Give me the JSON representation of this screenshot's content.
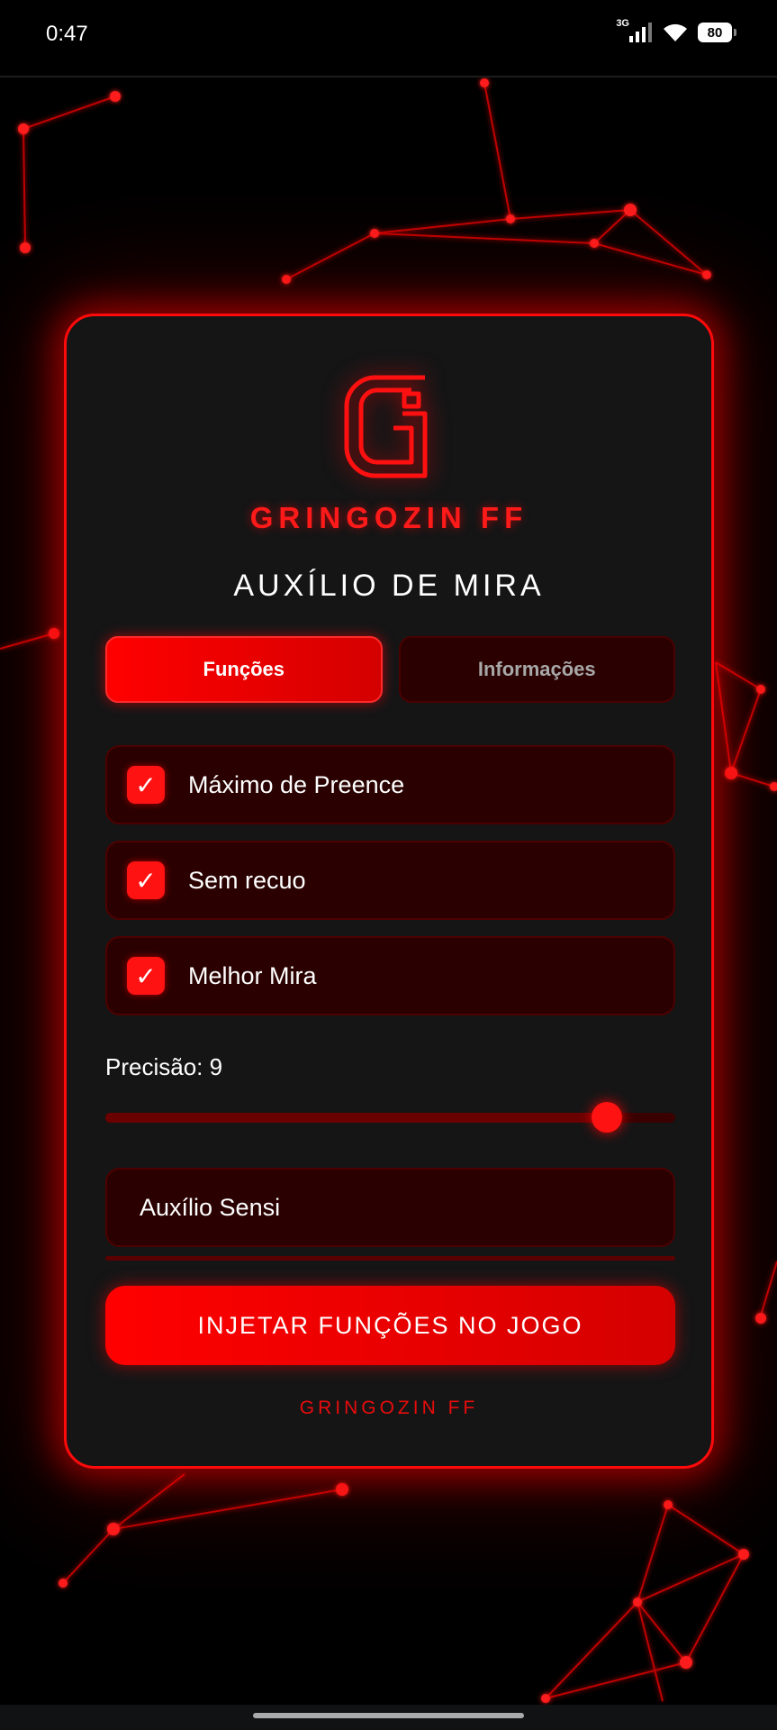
{
  "status_bar": {
    "time": "0:47",
    "network_type": "3G",
    "battery": "80",
    "icons": [
      "signal-icon",
      "wifi-icon",
      "battery-icon"
    ]
  },
  "card": {
    "logo_icon": "g-logo-icon",
    "brand": "GRINGOZIN FF",
    "title": "AUXÍLIO DE MIRA",
    "tabs": [
      {
        "label": "Funções",
        "active": true
      },
      {
        "label": "Informações",
        "active": false
      }
    ],
    "options": [
      {
        "label": "Máximo de Preence",
        "checked": true
      },
      {
        "label": "Sem recuo",
        "checked": true
      },
      {
        "label": "Melhor Mira",
        "checked": true
      }
    ],
    "check_glyph": "✓",
    "precision_label": "Precisão: 9",
    "precision_level": 0.88,
    "sensi_value": "Auxílio Sensi",
    "inject_button": "INJETAR FUNÇÕES NO JOGO",
    "footer_brand": "GRINGOZIN FF"
  },
  "colors": {
    "accent": "#ff0000",
    "card_bg": "#151516",
    "field_bg": "#2a0000"
  }
}
